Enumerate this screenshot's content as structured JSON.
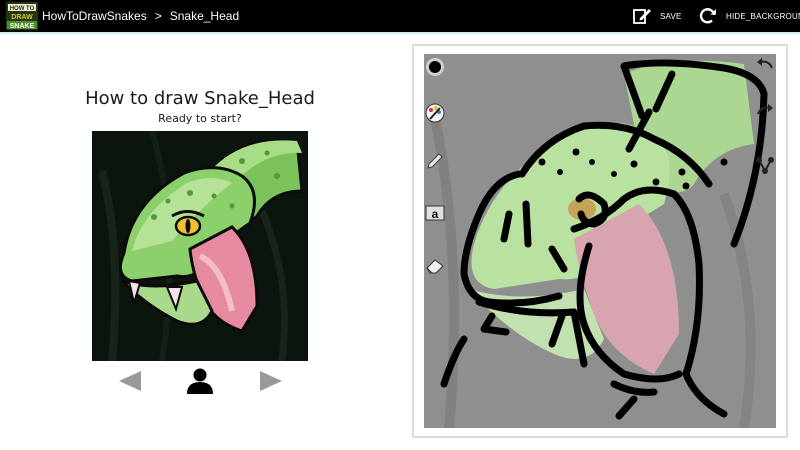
{
  "actionbar": {
    "logo_text": [
      "HOW TO",
      "DRAW",
      "SNAKE"
    ],
    "app_crumb": "HowToDrawSnakes",
    "separator": ">",
    "page_crumb": "Snake_Head",
    "save_label": "SAVE",
    "hide_background_label": "HIDE_BACKGROUND"
  },
  "lesson": {
    "title": "How to draw Snake_Head",
    "subtitle": "Ready to start?"
  },
  "icons": {
    "logo": "app-logo-icon",
    "save": "save-note-icon",
    "hide_background": "refresh-icon",
    "prev": "arrow-left-icon",
    "user": "person-icon",
    "next": "arrow-right-icon",
    "tools": [
      "brush-size-icon",
      "color-picker-icon",
      "pencil-icon",
      "text-tool-icon",
      "eraser-icon",
      "undo-icon",
      "redo-icon",
      "share-icon"
    ]
  },
  "colors": {
    "actionbar_bg": "#000000",
    "divider": "#d9ecf5",
    "snake_green": "#8bd06a",
    "snake_light": "#c9e8a6",
    "mouth_pink": "#e58aa0",
    "eye_yellow": "#f1c12b",
    "canvas_bg": "#8f8f8f",
    "nav_gray": "#999999"
  }
}
